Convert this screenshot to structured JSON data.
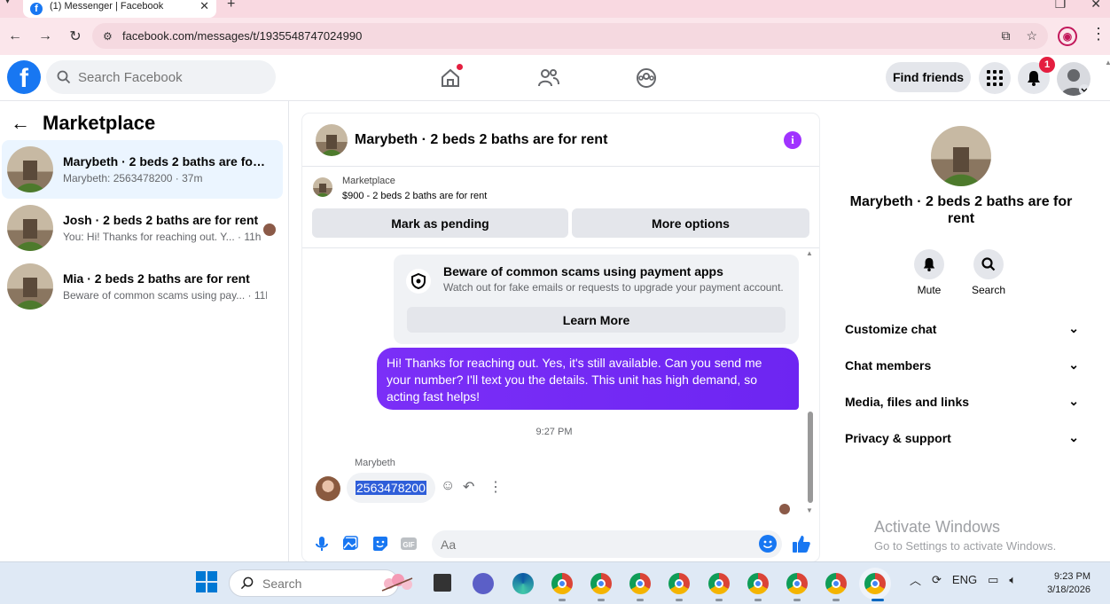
{
  "browser": {
    "tab_title": "(1) Messenger | Facebook",
    "url": "facebook.com/messages/t/1935548747024990"
  },
  "header": {
    "search_placeholder": "Search Facebook",
    "find_friends": "Find friends",
    "notification_count": "1"
  },
  "sidebar": {
    "title": "Marketplace",
    "conversations": [
      {
        "name": "Marybeth · 2 beds 2 baths are for ...",
        "preview": "Marybeth: 2563478200 · 37m",
        "active": true
      },
      {
        "name": "Josh · 2 beds 2 baths are for rent",
        "preview": "You: Hi! Thanks for reaching out. Y... · 11h",
        "active": false
      },
      {
        "name": "Mia · 2 beds 2 baths are for rent",
        "preview": "Beware of common scams using pay... · 11h",
        "active": false
      }
    ]
  },
  "chat": {
    "title": "Marybeth · 2 beds 2 baths are for rent",
    "listing_source": "Marketplace",
    "listing_price_title": "$900 - 2 beds 2 baths are for rent",
    "mark_pending": "Mark as pending",
    "more_options": "More options",
    "scam_title": "Beware of common scams using payment apps",
    "scam_desc": "Watch out for fake emails or requests to upgrade your payment account.",
    "learn_more": "Learn More",
    "outgoing_message": "Hi! Thanks for reaching out. Yes, it's still available. Can you send me your number? I'll text you the details. This unit has high demand, so acting fast helps!",
    "timestamp": "9:27 PM",
    "sender_name": "Marybeth",
    "incoming_message": "2563478200",
    "composer_placeholder": "Aa",
    "colors": {
      "accent": "#1877f2",
      "outgoing_bubble": "#7b2ff7",
      "info": "#a033ff"
    }
  },
  "details": {
    "name": "Marybeth · 2 beds 2 baths are for rent",
    "mute": "Mute",
    "search": "Search",
    "sections": [
      "Customize chat",
      "Chat members",
      "Media, files and links",
      "Privacy & support"
    ]
  },
  "watermark": {
    "line1": "Activate Windows",
    "line2": "Go to Settings to activate Windows."
  },
  "taskbar": {
    "search_placeholder": "Search",
    "language": "ENG",
    "time": "9:23 PM",
    "date": "3/18/2026"
  }
}
